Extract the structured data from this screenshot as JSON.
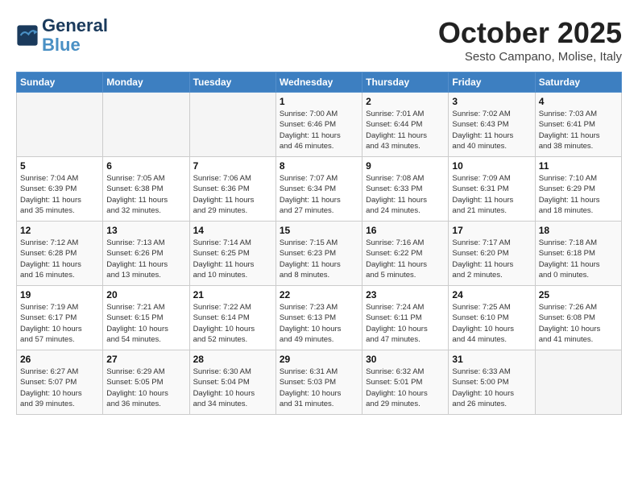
{
  "logo": {
    "line1": "General",
    "line2": "Blue"
  },
  "title": "October 2025",
  "subtitle": "Sesto Campano, Molise, Italy",
  "headers": [
    "Sunday",
    "Monday",
    "Tuesday",
    "Wednesday",
    "Thursday",
    "Friday",
    "Saturday"
  ],
  "weeks": [
    [
      {
        "day": "",
        "info": ""
      },
      {
        "day": "",
        "info": ""
      },
      {
        "day": "",
        "info": ""
      },
      {
        "day": "1",
        "info": "Sunrise: 7:00 AM\nSunset: 6:46 PM\nDaylight: 11 hours\nand 46 minutes."
      },
      {
        "day": "2",
        "info": "Sunrise: 7:01 AM\nSunset: 6:44 PM\nDaylight: 11 hours\nand 43 minutes."
      },
      {
        "day": "3",
        "info": "Sunrise: 7:02 AM\nSunset: 6:43 PM\nDaylight: 11 hours\nand 40 minutes."
      },
      {
        "day": "4",
        "info": "Sunrise: 7:03 AM\nSunset: 6:41 PM\nDaylight: 11 hours\nand 38 minutes."
      }
    ],
    [
      {
        "day": "5",
        "info": "Sunrise: 7:04 AM\nSunset: 6:39 PM\nDaylight: 11 hours\nand 35 minutes."
      },
      {
        "day": "6",
        "info": "Sunrise: 7:05 AM\nSunset: 6:38 PM\nDaylight: 11 hours\nand 32 minutes."
      },
      {
        "day": "7",
        "info": "Sunrise: 7:06 AM\nSunset: 6:36 PM\nDaylight: 11 hours\nand 29 minutes."
      },
      {
        "day": "8",
        "info": "Sunrise: 7:07 AM\nSunset: 6:34 PM\nDaylight: 11 hours\nand 27 minutes."
      },
      {
        "day": "9",
        "info": "Sunrise: 7:08 AM\nSunset: 6:33 PM\nDaylight: 11 hours\nand 24 minutes."
      },
      {
        "day": "10",
        "info": "Sunrise: 7:09 AM\nSunset: 6:31 PM\nDaylight: 11 hours\nand 21 minutes."
      },
      {
        "day": "11",
        "info": "Sunrise: 7:10 AM\nSunset: 6:29 PM\nDaylight: 11 hours\nand 18 minutes."
      }
    ],
    [
      {
        "day": "12",
        "info": "Sunrise: 7:12 AM\nSunset: 6:28 PM\nDaylight: 11 hours\nand 16 minutes."
      },
      {
        "day": "13",
        "info": "Sunrise: 7:13 AM\nSunset: 6:26 PM\nDaylight: 11 hours\nand 13 minutes."
      },
      {
        "day": "14",
        "info": "Sunrise: 7:14 AM\nSunset: 6:25 PM\nDaylight: 11 hours\nand 10 minutes."
      },
      {
        "day": "15",
        "info": "Sunrise: 7:15 AM\nSunset: 6:23 PM\nDaylight: 11 hours\nand 8 minutes."
      },
      {
        "day": "16",
        "info": "Sunrise: 7:16 AM\nSunset: 6:22 PM\nDaylight: 11 hours\nand 5 minutes."
      },
      {
        "day": "17",
        "info": "Sunrise: 7:17 AM\nSunset: 6:20 PM\nDaylight: 11 hours\nand 2 minutes."
      },
      {
        "day": "18",
        "info": "Sunrise: 7:18 AM\nSunset: 6:18 PM\nDaylight: 11 hours\nand 0 minutes."
      }
    ],
    [
      {
        "day": "19",
        "info": "Sunrise: 7:19 AM\nSunset: 6:17 PM\nDaylight: 10 hours\nand 57 minutes."
      },
      {
        "day": "20",
        "info": "Sunrise: 7:21 AM\nSunset: 6:15 PM\nDaylight: 10 hours\nand 54 minutes."
      },
      {
        "day": "21",
        "info": "Sunrise: 7:22 AM\nSunset: 6:14 PM\nDaylight: 10 hours\nand 52 minutes."
      },
      {
        "day": "22",
        "info": "Sunrise: 7:23 AM\nSunset: 6:13 PM\nDaylight: 10 hours\nand 49 minutes."
      },
      {
        "day": "23",
        "info": "Sunrise: 7:24 AM\nSunset: 6:11 PM\nDaylight: 10 hours\nand 47 minutes."
      },
      {
        "day": "24",
        "info": "Sunrise: 7:25 AM\nSunset: 6:10 PM\nDaylight: 10 hours\nand 44 minutes."
      },
      {
        "day": "25",
        "info": "Sunrise: 7:26 AM\nSunset: 6:08 PM\nDaylight: 10 hours\nand 41 minutes."
      }
    ],
    [
      {
        "day": "26",
        "info": "Sunrise: 6:27 AM\nSunset: 5:07 PM\nDaylight: 10 hours\nand 39 minutes."
      },
      {
        "day": "27",
        "info": "Sunrise: 6:29 AM\nSunset: 5:05 PM\nDaylight: 10 hours\nand 36 minutes."
      },
      {
        "day": "28",
        "info": "Sunrise: 6:30 AM\nSunset: 5:04 PM\nDaylight: 10 hours\nand 34 minutes."
      },
      {
        "day": "29",
        "info": "Sunrise: 6:31 AM\nSunset: 5:03 PM\nDaylight: 10 hours\nand 31 minutes."
      },
      {
        "day": "30",
        "info": "Sunrise: 6:32 AM\nSunset: 5:01 PM\nDaylight: 10 hours\nand 29 minutes."
      },
      {
        "day": "31",
        "info": "Sunrise: 6:33 AM\nSunset: 5:00 PM\nDaylight: 10 hours\nand 26 minutes."
      },
      {
        "day": "",
        "info": ""
      }
    ]
  ]
}
